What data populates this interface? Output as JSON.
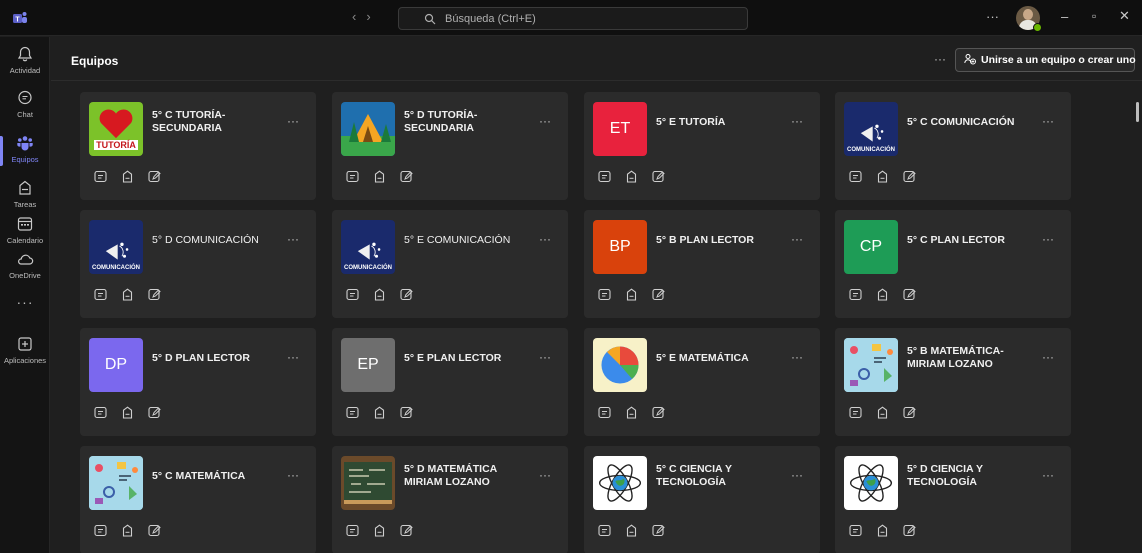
{
  "titlebar": {
    "search_placeholder": "Búsqueda (Ctrl+E)",
    "more": "···",
    "back": "‹",
    "forward": "›",
    "minimize": "–",
    "maximize": "▫",
    "close": "✕"
  },
  "rail": {
    "items": [
      {
        "label": "Actividad",
        "icon": "bell-icon"
      },
      {
        "label": "Chat",
        "icon": "chat-icon"
      },
      {
        "label": "Equipos",
        "icon": "teams-icon",
        "active": true
      },
      {
        "label": "Tareas",
        "icon": "assignments-icon"
      },
      {
        "label": "Calendario",
        "icon": "calendar-icon"
      },
      {
        "label": "OneDrive",
        "icon": "cloud-icon"
      }
    ],
    "more": "···",
    "apps_label": "Aplicaciones"
  },
  "header": {
    "title": "Equipos",
    "more": "···",
    "join_label": "Unirse a un equipo o crear uno"
  },
  "teams": [
    {
      "name": "5° C TUTORÍA-SECUNDARIA",
      "thumb": "heart",
      "thumb_text": "TUTORÍA"
    },
    {
      "name": "5° D TUTORÍA-SECUNDARIA",
      "thumb": "tent"
    },
    {
      "name": "5° E TUTORÍA",
      "thumb": "initials",
      "initials": "ET",
      "color": "#e8223d"
    },
    {
      "name": "5° C COMUNICACIÓN",
      "thumb": "comm",
      "thumb_text": "COMUNICACIÓN"
    },
    {
      "name": "5° D COMUNICACIÓN",
      "thumb": "comm",
      "thumb_text": "COMUNICACIÓN",
      "regular": true
    },
    {
      "name": "5° E COMUNICACIÓN",
      "thumb": "comm",
      "thumb_text": "COMUNICACIÓN",
      "regular": true
    },
    {
      "name": "5° B PLAN LECTOR",
      "thumb": "initials",
      "initials": "BP",
      "color": "#d9420c"
    },
    {
      "name": "5° C PLAN LECTOR",
      "thumb": "initials",
      "initials": "CP",
      "color": "#1e9c56"
    },
    {
      "name": "5° D PLAN LECTOR",
      "thumb": "initials",
      "initials": "DP",
      "color": "#7b68ee"
    },
    {
      "name": "5° E PLAN LECTOR",
      "thumb": "initials",
      "initials": "EP",
      "color": "#6e6e6e"
    },
    {
      "name": "5° E MATEMÁTICA",
      "thumb": "pie"
    },
    {
      "name": "5° B MATEMÁTICA-MIRIAM LOZANO",
      "thumb": "doodle"
    },
    {
      "name": "5° C MATEMÁTICA",
      "thumb": "doodle"
    },
    {
      "name": "5° D MATEMÁTICA MIRIAM LOZANO",
      "thumb": "chalkboard"
    },
    {
      "name": "5° C CIENCIA Y TECNOLOGÍA",
      "thumb": "atom"
    },
    {
      "name": "5° D CIENCIA Y TECNOLOGÍA",
      "thumb": "atom"
    }
  ],
  "card_more": "···"
}
